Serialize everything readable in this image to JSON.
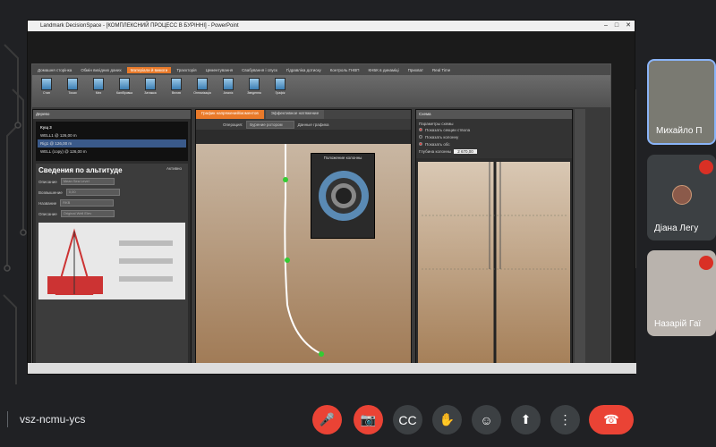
{
  "meeting": {
    "code": "vsz-ncmu-ycs"
  },
  "shared_window": {
    "title": "Landmark DecisionSpace - [КОМПЛЕКСНИЙ ПРОЦЕСС В БУРІННІ] - PowerPoint",
    "ribbon_tabs": [
      "Домашня сторінка",
      "Обмін вихідних даних",
      "Матеріали й вимоги",
      "Траєкторія",
      "Цементування",
      "Свабування і спуск",
      "Гідравліка дотиску",
      "Контроль ГНВП",
      "КНБК в динаміці",
      "Прихват",
      "Real Time"
    ],
    "active_ribbon_tab": "Матеріали й вимоги",
    "ribbon_buttons": [
      "Стан",
      "Тиски",
      "Мех",
      "Калібровка",
      "Затяжка",
      "Вплив",
      "Оптимізація",
      "Аналіз",
      "Зведення",
      "Графік"
    ],
    "left_panel": {
      "header": "Дерево",
      "wells": [
        {
          "label": "Кущ 3",
          "hdr": true
        },
        {
          "label": "WELL1 @ 126,00 m",
          "hdr": false
        },
        {
          "label": "Rig1 @ 126,00 m",
          "hdr": false
        },
        {
          "label": "WELL (copy) @ 126,00 m",
          "hdr": false
        }
      ],
      "section_title": "Сведения по альтитуде",
      "section_sub": "Активно",
      "fields": [
        {
          "label": "Описание",
          "value": "Mean Sea Level"
        },
        {
          "label": "Возвышение",
          "value": "0,00"
        },
        {
          "label": "Название",
          "value": "RKB"
        },
        {
          "label": "Описание",
          "value": "Original Well Elev"
        }
      ]
    },
    "middle_panel": {
      "tabs": [
        "График напряжений/моментов",
        "Эффективное натяжение"
      ],
      "active_tab": "График напряжений/моментов",
      "operation_label": "Операция:",
      "operation_value": "Бурение ротором",
      "extra_label": "Данные графика",
      "popup_title": "Положение колонны"
    },
    "right_panel": {
      "header": "Схема",
      "params_title": "Параметры схемы",
      "options": [
        {
          "label": "Показать секции ствола",
          "on": true
        },
        {
          "label": "Показать колонну",
          "on": false
        },
        {
          "label": "Показать обс",
          "on": true
        }
      ],
      "depth_label": "Глубина колонны",
      "depth_value": "2 670,00"
    }
  },
  "participants": [
    {
      "name": "Михайло П",
      "muted": false
    },
    {
      "name": "Діана Легу",
      "muted": true
    },
    {
      "name": "Назарій Гаї",
      "muted": true
    }
  ],
  "controls": [
    {
      "name": "mic-off-button",
      "icon": "🎤",
      "red": true
    },
    {
      "name": "camera-off-button",
      "icon": "📷",
      "red": true
    },
    {
      "name": "captions-button",
      "icon": "CC",
      "red": false
    },
    {
      "name": "raise-hand-button",
      "icon": "✋",
      "red": false
    },
    {
      "name": "reactions-button",
      "icon": "☺",
      "red": false
    },
    {
      "name": "present-button",
      "icon": "⬆",
      "red": false
    },
    {
      "name": "more-options-button",
      "icon": "⋮",
      "red": false
    }
  ],
  "colors": {
    "accent": "#e97a2a",
    "meet_bg": "#202124",
    "hangup": "#ea4335"
  }
}
